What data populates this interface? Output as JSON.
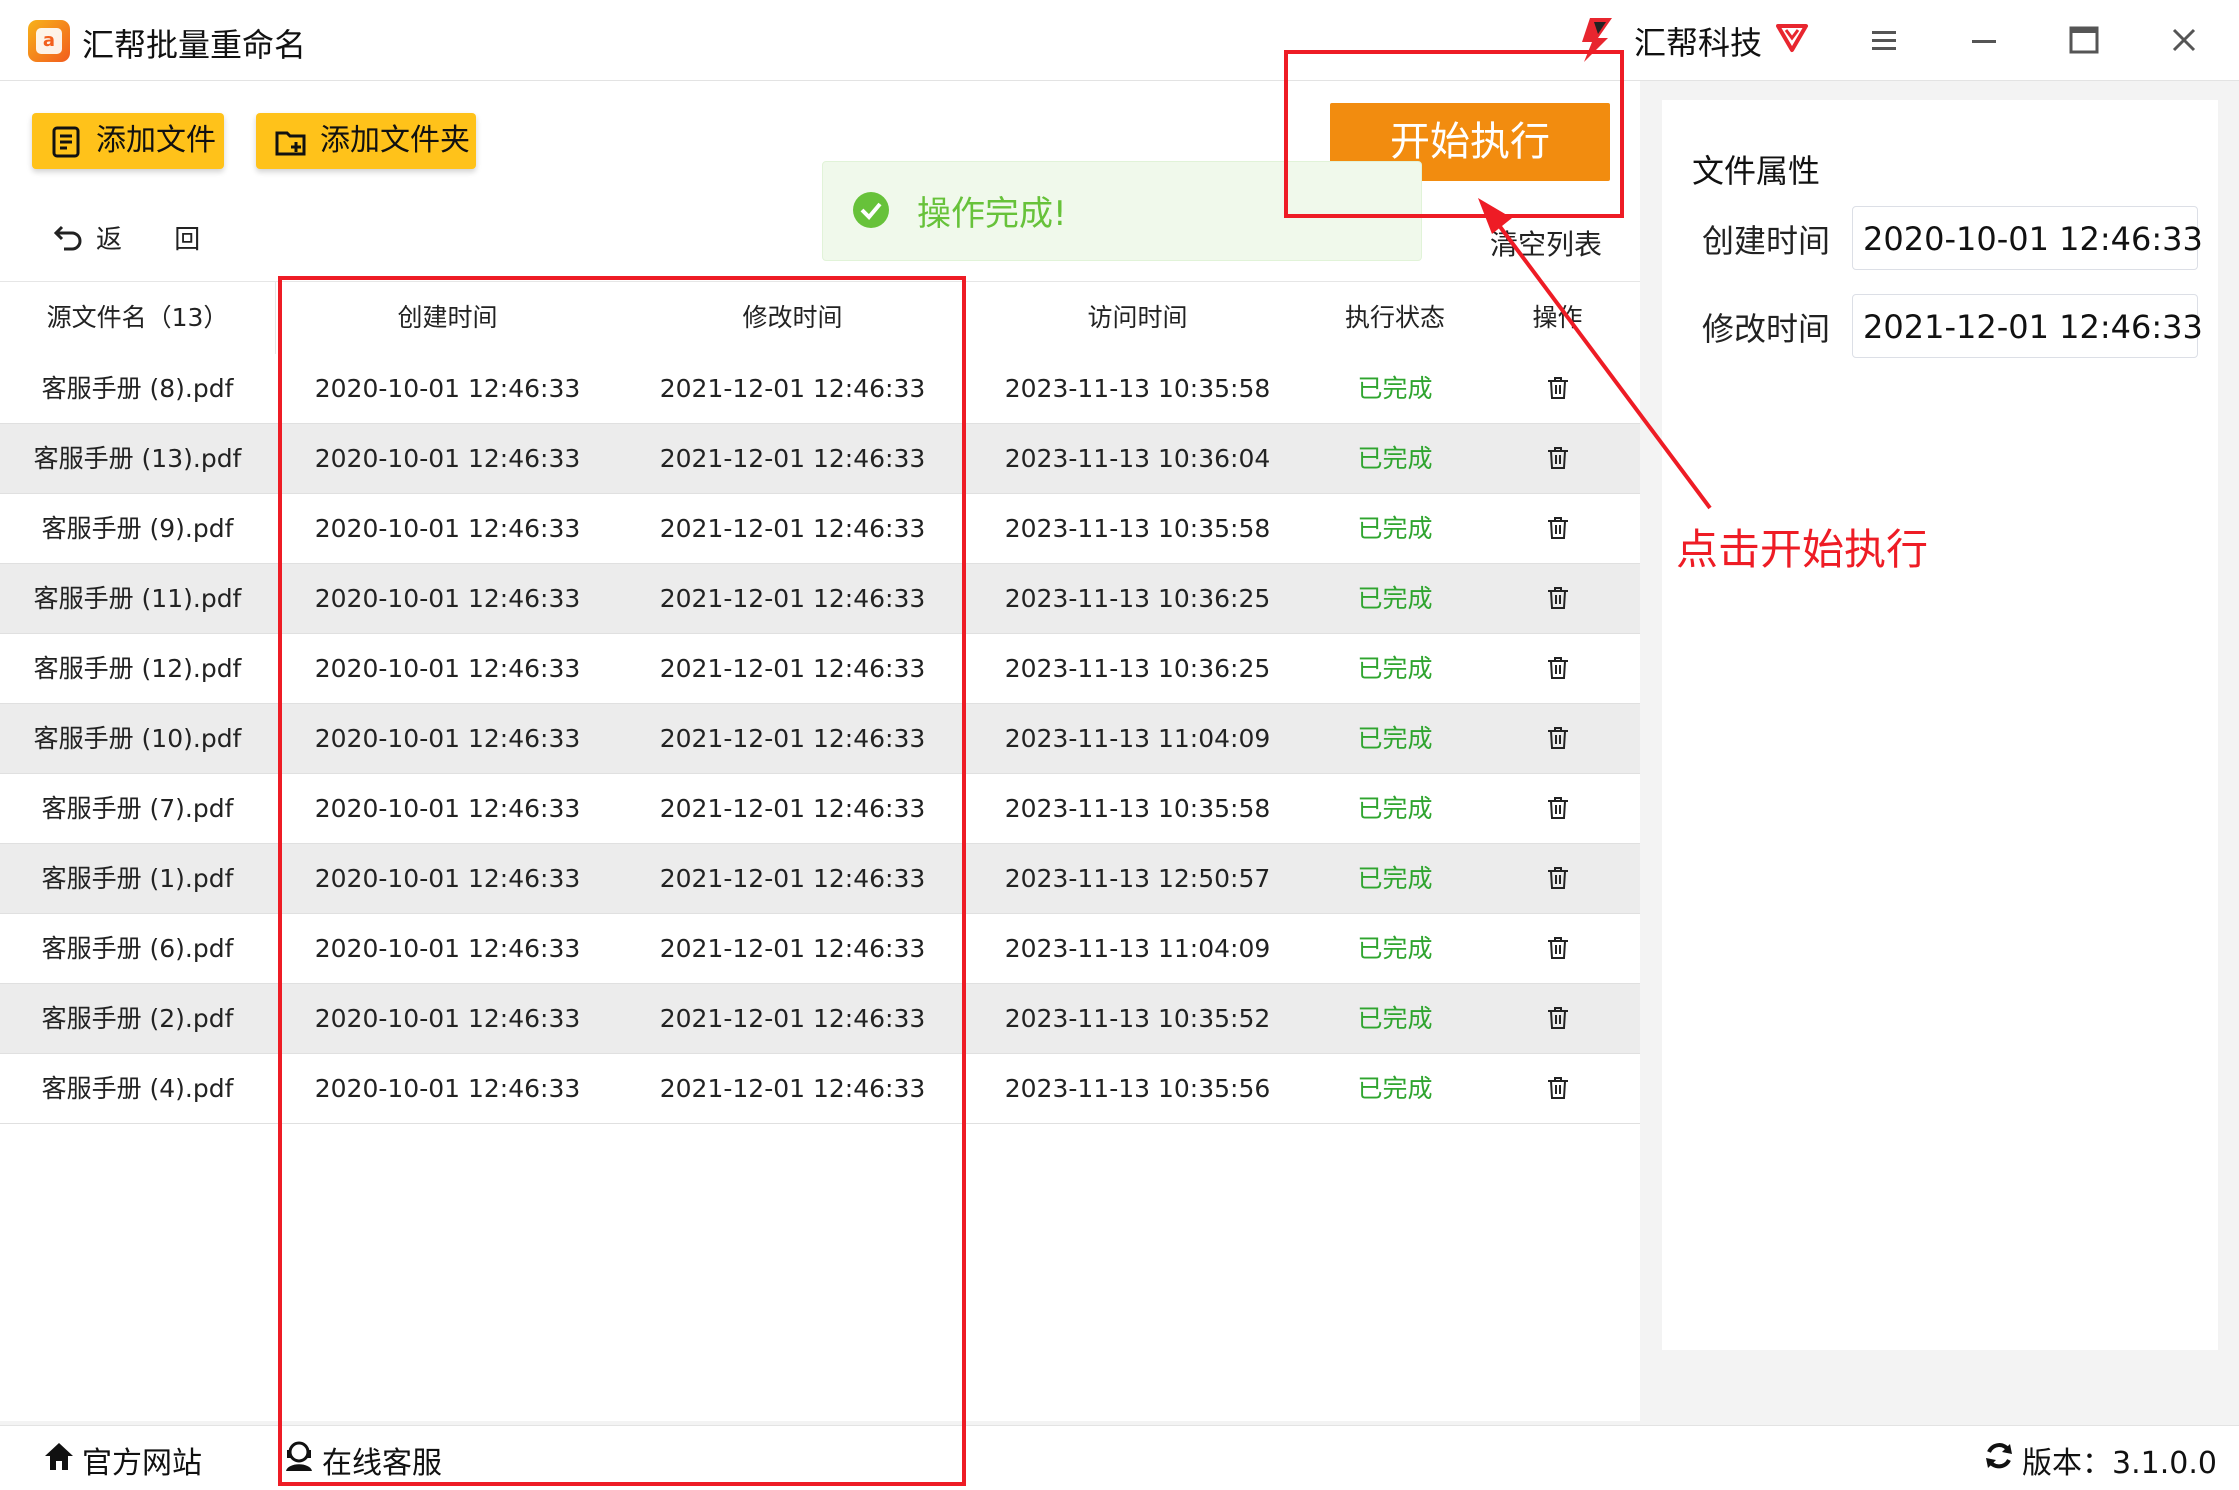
{
  "app": {
    "title": "汇帮批量重命名",
    "brand": "汇帮科技",
    "logo_glyph": "a"
  },
  "window_controls": [
    "menu-icon",
    "minimize-icon",
    "maximize-icon",
    "close-icon"
  ],
  "toolbar": {
    "add_file": "添加文件",
    "add_folder": "添加文件夹",
    "start": "开始执行",
    "back": "返 回",
    "clear": "清空列表"
  },
  "toast": {
    "message": "操作完成!"
  },
  "table": {
    "headers": [
      "源文件名（13）",
      "创建时间",
      "修改时间",
      "访问时间",
      "执行状态",
      "操作"
    ],
    "rows": [
      {
        "name": "客服手册 (8).pdf",
        "created": "2020-10-01 12:46:33",
        "modified": "2021-12-01 12:46:33",
        "accessed": "2023-11-13 10:35:58",
        "status": "已完成"
      },
      {
        "name": "客服手册 (13).pdf",
        "created": "2020-10-01 12:46:33",
        "modified": "2021-12-01 12:46:33",
        "accessed": "2023-11-13 10:36:04",
        "status": "已完成"
      },
      {
        "name": "客服手册 (9).pdf",
        "created": "2020-10-01 12:46:33",
        "modified": "2021-12-01 12:46:33",
        "accessed": "2023-11-13 10:35:58",
        "status": "已完成"
      },
      {
        "name": "客服手册 (11).pdf",
        "created": "2020-10-01 12:46:33",
        "modified": "2021-12-01 12:46:33",
        "accessed": "2023-11-13 10:36:25",
        "status": "已完成"
      },
      {
        "name": "客服手册 (12).pdf",
        "created": "2020-10-01 12:46:33",
        "modified": "2021-12-01 12:46:33",
        "accessed": "2023-11-13 10:36:25",
        "status": "已完成"
      },
      {
        "name": "客服手册 (10).pdf",
        "created": "2020-10-01 12:46:33",
        "modified": "2021-12-01 12:46:33",
        "accessed": "2023-11-13 11:04:09",
        "status": "已完成"
      },
      {
        "name": "客服手册 (7).pdf",
        "created": "2020-10-01 12:46:33",
        "modified": "2021-12-01 12:46:33",
        "accessed": "2023-11-13 10:35:58",
        "status": "已完成"
      },
      {
        "name": "客服手册 (1).pdf",
        "created": "2020-10-01 12:46:33",
        "modified": "2021-12-01 12:46:33",
        "accessed": "2023-11-13 12:50:57",
        "status": "已完成"
      },
      {
        "name": "客服手册 (6).pdf",
        "created": "2020-10-01 12:46:33",
        "modified": "2021-12-01 12:46:33",
        "accessed": "2023-11-13 11:04:09",
        "status": "已完成"
      },
      {
        "name": "客服手册 (2).pdf",
        "created": "2020-10-01 12:46:33",
        "modified": "2021-12-01 12:46:33",
        "accessed": "2023-11-13 10:35:52",
        "status": "已完成"
      },
      {
        "name": "客服手册 (4).pdf",
        "created": "2020-10-01 12:46:33",
        "modified": "2021-12-01 12:46:33",
        "accessed": "2023-11-13 10:35:56",
        "status": "已完成"
      }
    ]
  },
  "side_panel": {
    "title": "文件属性",
    "created_label": "创建时间",
    "created_value": "2020-10-01 12:46:33",
    "modified_label": "修改时间",
    "modified_value": "2021-12-01 12:46:33"
  },
  "footer": {
    "website": "官方网站",
    "support": "在线客服",
    "version": "版本：3.1.0.0"
  },
  "annotation": {
    "text": "点击开始执行"
  },
  "colors": {
    "accent_yellow": "#ffc21a",
    "start_orange": "#f28c0f",
    "status_green": "#2fa52f",
    "annotation_red": "#ee1c25",
    "toast_green": "#67c23a"
  }
}
